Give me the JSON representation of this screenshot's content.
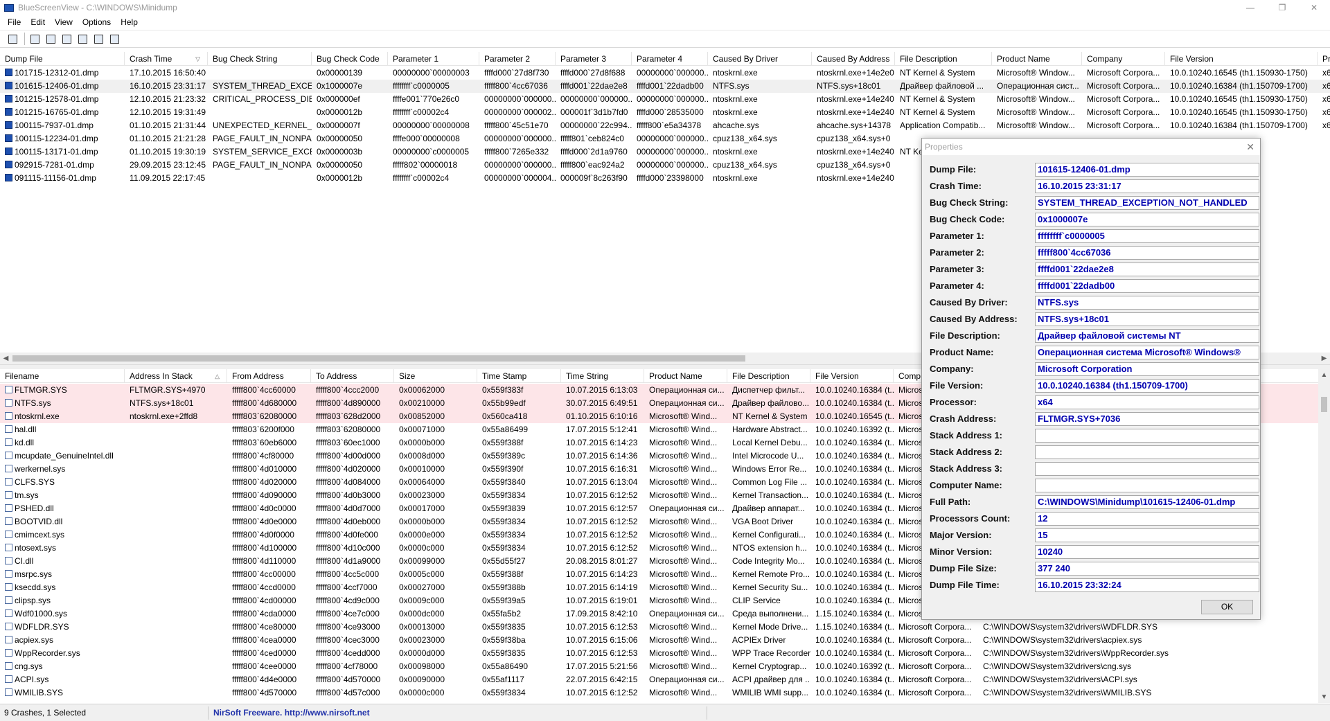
{
  "window": {
    "title": "BlueScreenView - C:\\WINDOWS\\Minidump",
    "minimize": "—",
    "maximize": "❐",
    "close": "✕"
  },
  "menu": [
    "File",
    "Edit",
    "View",
    "Options",
    "Help"
  ],
  "toolbar": [
    {
      "icon": "properties-icon"
    },
    {
      "icon": "save-icon"
    },
    {
      "icon": "refresh-icon"
    },
    {
      "icon": "copy-icon"
    },
    {
      "icon": "html-report-icon"
    },
    {
      "icon": "find-icon"
    },
    {
      "icon": "exit-icon"
    }
  ],
  "top_columns": [
    "Dump File",
    "Crash Time",
    "Bug Check String",
    "Bug Check Code",
    "Parameter 1",
    "Parameter 2",
    "Parameter 3",
    "Parameter 4",
    "Caused By Driver",
    "Caused By Address",
    "File Description",
    "Product Name",
    "Company",
    "File Version",
    "Pr"
  ],
  "top_sort_column": "Crash Time",
  "top_rows": [
    [
      "101715-12312-01.dmp",
      "17.10.2015 16:50:40",
      "",
      "0x00000139",
      "00000000`00000003",
      "ffffd000`27d8f730",
      "ffffd000`27d8f688",
      "00000000`000000...",
      "ntoskrnl.exe",
      "ntoskrnl.exe+14e2e0",
      "NT Kernel & System",
      "Microsoft® Window...",
      "Microsoft Corpora...",
      "10.0.10240.16545 (th1.150930-1750)",
      "x6"
    ],
    [
      "101615-12406-01.dmp",
      "16.10.2015 23:31:17",
      "SYSTEM_THREAD_EXCE...",
      "0x1000007e",
      "ffffffff`c0000005",
      "fffff800`4cc67036",
      "ffffd001`22dae2e8",
      "ffffd001`22dadb00",
      "NTFS.sys",
      "NTFS.sys+18c01",
      "Драйвер файловой ...",
      "Операционная сист...",
      "Microsoft Corpora...",
      "10.0.10240.16384 (th1.150709-1700)",
      "x6"
    ],
    [
      "101215-12578-01.dmp",
      "12.10.2015 21:23:32",
      "CRITICAL_PROCESS_DIED",
      "0x000000ef",
      "ffffe001`770e26c0",
      "00000000`000000...",
      "00000000`000000...",
      "00000000`000000...",
      "ntoskrnl.exe",
      "ntoskrnl.exe+14e240",
      "NT Kernel & System",
      "Microsoft® Window...",
      "Microsoft Corpora...",
      "10.0.10240.16545 (th1.150930-1750)",
      "x6"
    ],
    [
      "101215-16765-01.dmp",
      "12.10.2015 19:31:49",
      "",
      "0x0000012b",
      "ffffffff`c00002c4",
      "00000000`000002...",
      "000001f`3d1b7fd0",
      "ffffd000`28535000",
      "ntoskrnl.exe",
      "ntoskrnl.exe+14e240",
      "NT Kernel & System",
      "Microsoft® Window...",
      "Microsoft Corpora...",
      "10.0.10240.16545 (th1.150930-1750)",
      "x6"
    ],
    [
      "100115-7937-01.dmp",
      "01.10.2015 21:31:44",
      "UNEXPECTED_KERNEL_...",
      "0x0000007f",
      "00000000`00000008",
      "fffff800`45c51e70",
      "00000000`22c994...",
      "fffff800`e5a34378",
      "ahcache.sys",
      "ahcache.sys+14378",
      "Application Compatib...",
      "Microsoft® Window...",
      "Microsoft Corpora...",
      "10.0.10240.16384 (th1.150709-1700)",
      "x6"
    ],
    [
      "100115-12234-01.dmp",
      "01.10.2015 21:21:28",
      "PAGE_FAULT_IN_NONPA...",
      "0x00000050",
      "ffffe000`00000008",
      "00000000`000000...",
      "fffff801`ceb824c0",
      "00000000`000000...",
      "cpuz138_x64.sys",
      "cpuz138_x64.sys+0",
      "",
      "",
      "",
      "",
      ""
    ],
    [
      "100115-13171-01.dmp",
      "01.10.2015 19:30:19",
      "SYSTEM_SERVICE_EXCE...",
      "0x0000003b",
      "00000000`c0000005",
      "fffff800`7265e332",
      "ffffd000`2d1a9760",
      "00000000`000000...",
      "ntoskrnl.exe",
      "ntoskrnl.exe+14e240",
      "NT Ke",
      "",
      "",
      "930-1750)",
      ""
    ],
    [
      "092915-7281-01.dmp",
      "29.09.2015 23:12:45",
      "PAGE_FAULT_IN_NONPA...",
      "0x00000050",
      "fffff802`00000018",
      "00000000`000000...",
      "fffff800`eac924a2",
      "00000000`000000...",
      "cpuz138_x64.sys",
      "cpuz138_x64.sys+0",
      "",
      "",
      "",
      "",
      ""
    ],
    [
      "091115-11156-01.dmp",
      "11.09.2015 22:17:45",
      "",
      "0x0000012b",
      "ffffffff`c00002c4",
      "00000000`000004...",
      "000009f`8c263f90",
      "ffffd000`23398000",
      "ntoskrnl.exe",
      "ntoskrnl.exe+14e240",
      "",
      "",
      "",
      "930-1750)",
      ""
    ]
  ],
  "top_selected_index": 1,
  "bottom_columns": [
    "Filename",
    "Address In Stack",
    "From Address",
    "To Address",
    "Size",
    "Time Stamp",
    "Time String",
    "Product Name",
    "File Description",
    "File Version",
    "Comp"
  ],
  "bottom_sort_column": "Address In Stack",
  "bottom_rows": [
    [
      "FLTMGR.SYS",
      "FLTMGR.SYS+4970",
      "fffff800`4cc60000",
      "fffff800`4ccc2000",
      "0x00062000",
      "0x559f383f",
      "10.07.2015 6:13:03",
      "Операционная си...",
      "Диспетчер фильт...",
      "10.0.10240.16384 (t...",
      "Micros",
      ""
    ],
    [
      "NTFS.sys",
      "NTFS.sys+18c01",
      "fffff800`4d680000",
      "fffff800`4d890000",
      "0x00210000",
      "0x55b99edf",
      "30.07.2015 6:49:51",
      "Операционная си...",
      "Драйвер файлово...",
      "10.0.10240.16384 (t...",
      "Micros",
      ""
    ],
    [
      "ntoskrnl.exe",
      "ntoskrnl.exe+2ffd8",
      "fffff803`62080000",
      "fffff803`628d2000",
      "0x00852000",
      "0x560ca418",
      "01.10.2015 6:10:16",
      "Microsoft® Wind...",
      "NT Kernel & System",
      "10.0.10240.16545 (t...",
      "Micros",
      ""
    ],
    [
      "hal.dll",
      "",
      "fffff803`6200f000",
      "fffff803`62080000",
      "0x00071000",
      "0x55a86499",
      "17.07.2015 5:12:41",
      "Microsoft® Wind...",
      "Hardware Abstract...",
      "10.0.10240.16392 (t...",
      "Micros",
      ""
    ],
    [
      "kd.dll",
      "",
      "fffff803`60eb6000",
      "fffff803`60ec1000",
      "0x0000b000",
      "0x559f388f",
      "10.07.2015 6:14:23",
      "Microsoft® Wind...",
      "Local Kernel Debu...",
      "10.0.10240.16384 (t...",
      "Micros",
      ""
    ],
    [
      "mcupdate_GenuineIntel.dll",
      "",
      "fffff800`4cf80000",
      "fffff800`4d00d000",
      "0x0008d000",
      "0x559f389c",
      "10.07.2015 6:14:36",
      "Microsoft® Wind...",
      "Intel Microcode U...",
      "10.0.10240.16384 (t...",
      "Micros",
      ""
    ],
    [
      "werkernel.sys",
      "",
      "fffff800`4d010000",
      "fffff800`4d020000",
      "0x00010000",
      "0x559f390f",
      "10.07.2015 6:16:31",
      "Microsoft® Wind...",
      "Windows Error Re...",
      "10.0.10240.16384 (t...",
      "Micros",
      ""
    ],
    [
      "CLFS.SYS",
      "",
      "fffff800`4d020000",
      "fffff800`4d084000",
      "0x00064000",
      "0x559f3840",
      "10.07.2015 6:13:04",
      "Microsoft® Wind...",
      "Common Log File ...",
      "10.0.10240.16384 (t...",
      "Micros",
      ""
    ],
    [
      "tm.sys",
      "",
      "fffff800`4d090000",
      "fffff800`4d0b3000",
      "0x00023000",
      "0x559f3834",
      "10.07.2015 6:12:52",
      "Microsoft® Wind...",
      "Kernel Transaction...",
      "10.0.10240.16384 (t...",
      "Micros",
      ""
    ],
    [
      "PSHED.dll",
      "",
      "fffff800`4d0c0000",
      "fffff800`4d0d7000",
      "0x00017000",
      "0x559f3839",
      "10.07.2015 6:12:57",
      "Операционная си...",
      "Драйвер аппарат...",
      "10.0.10240.16384 (t...",
      "Micros",
      ""
    ],
    [
      "BOOTVID.dll",
      "",
      "fffff800`4d0e0000",
      "fffff800`4d0eb000",
      "0x0000b000",
      "0x559f3834",
      "10.07.2015 6:12:52",
      "Microsoft® Wind...",
      "VGA Boot Driver",
      "10.0.10240.16384 (t...",
      "Micros",
      ""
    ],
    [
      "cmimcext.sys",
      "",
      "fffff800`4d0f0000",
      "fffff800`4d0fe000",
      "0x0000e000",
      "0x559f3834",
      "10.07.2015 6:12:52",
      "Microsoft® Wind...",
      "Kernel Configurati...",
      "10.0.10240.16384 (t...",
      "Micros",
      ""
    ],
    [
      "ntosext.sys",
      "",
      "fffff800`4d100000",
      "fffff800`4d10c000",
      "0x0000c000",
      "0x559f3834",
      "10.07.2015 6:12:52",
      "Microsoft® Wind...",
      "NTOS extension h...",
      "10.0.10240.16384 (t...",
      "Micros",
      ""
    ],
    [
      "CI.dll",
      "",
      "fffff800`4d110000",
      "fffff800`4d1a9000",
      "0x00099000",
      "0x55d55f27",
      "20.08.2015 8:01:27",
      "Microsoft® Wind...",
      "Code Integrity Mo...",
      "10.0.10240.16384 (t...",
      "Micros",
      ""
    ],
    [
      "msrpc.sys",
      "",
      "fffff800`4cc00000",
      "fffff800`4cc5c000",
      "0x0005c000",
      "0x559f388f",
      "10.07.2015 6:14:23",
      "Microsoft® Wind...",
      "Kernel Remote Pro...",
      "10.0.10240.16384 (t...",
      "Micros",
      ""
    ],
    [
      "ksecdd.sys",
      "",
      "fffff800`4ccd0000",
      "fffff800`4ccf7000",
      "0x00027000",
      "0x559f388b",
      "10.07.2015 6:14:19",
      "Microsoft® Wind...",
      "Kernel Security Su...",
      "10.0.10240.16384 (t...",
      "Micros",
      ""
    ],
    [
      "clipsp.sys",
      "",
      "fffff800`4cd00000",
      "fffff800`4cd9c000",
      "0x0009c000",
      "0x559f39a5",
      "10.07.2015 6:19:01",
      "Microsoft® Wind...",
      "CLIP Service",
      "10.0.10240.16384 (t...",
      "Micros",
      ""
    ],
    [
      "Wdf01000.sys",
      "",
      "fffff800`4cda0000",
      "fffff800`4ce7c000",
      "0x000dc000",
      "0x55fa5b2",
      "17.09.2015 8:42:10",
      "Операционная си...",
      "Среда выполнени...",
      "1.15.10240.16384 (t...",
      "Micros",
      ""
    ],
    [
      "WDFLDR.SYS",
      "",
      "fffff800`4ce80000",
      "fffff800`4ce93000",
      "0x00013000",
      "0x559f3835",
      "10.07.2015 6:12:53",
      "Microsoft® Wind...",
      "Kernel Mode Drive...",
      "1.15.10240.16384 (t...",
      "Microsoft Corpora...",
      "C:\\WINDOWS\\system32\\drivers\\WDFLDR.SYS"
    ],
    [
      "acpiex.sys",
      "",
      "fffff800`4cea0000",
      "fffff800`4cec3000",
      "0x00023000",
      "0x559f38ba",
      "10.07.2015 6:15:06",
      "Microsoft® Wind...",
      "ACPIEx Driver",
      "10.0.10240.16384 (t...",
      "Microsoft Corpora...",
      "C:\\WINDOWS\\system32\\drivers\\acpiex.sys"
    ],
    [
      "WppRecorder.sys",
      "",
      "fffff800`4ced0000",
      "fffff800`4cedd000",
      "0x0000d000",
      "0x559f3835",
      "10.07.2015 6:12:53",
      "Microsoft® Wind...",
      "WPP Trace Recorder",
      "10.0.10240.16384 (t...",
      "Microsoft Corpora...",
      "C:\\WINDOWS\\system32\\drivers\\WppRecorder.sys"
    ],
    [
      "cng.sys",
      "",
      "fffff800`4cee0000",
      "fffff800`4cf78000",
      "0x00098000",
      "0x55a86490",
      "17.07.2015 5:21:56",
      "Microsoft® Wind...",
      "Kernel Cryptograp...",
      "10.0.10240.16392 (t...",
      "Microsoft Corpora...",
      "C:\\WINDOWS\\system32\\drivers\\cng.sys"
    ],
    [
      "ACPI.sys",
      "",
      "fffff800`4d4e0000",
      "fffff800`4d570000",
      "0x00090000",
      "0x55af1117",
      "22.07.2015 6:42:15",
      "Операционная си...",
      "ACPI драйвер для ...",
      "10.0.10240.16384 (t...",
      "Microsoft Corpora...",
      "C:\\WINDOWS\\system32\\drivers\\ACPI.sys"
    ],
    [
      "WMILIB.SYS",
      "",
      "fffff800`4d570000",
      "fffff800`4d57c000",
      "0x0000c000",
      "0x559f3834",
      "10.07.2015 6:12:52",
      "Microsoft® Wind...",
      "WMILIB WMI supp...",
      "10.0.10240.16384 (t...",
      "Microsoft Corpora...",
      "C:\\WINDOWS\\system32\\drivers\\WMILIB.SYS"
    ]
  ],
  "bottom_highlight_rows": 3,
  "status": {
    "left": "9 Crashes, 1 Selected",
    "right": "NirSoft Freeware.  http://www.nirsoft.net"
  },
  "dialog": {
    "title": "Properties",
    "close": "✕",
    "ok": "OK",
    "fields": [
      {
        "label": "Dump File:",
        "value": "101615-12406-01.dmp"
      },
      {
        "label": "Crash Time:",
        "value": "16.10.2015 23:31:17"
      },
      {
        "label": "Bug Check String:",
        "value": "SYSTEM_THREAD_EXCEPTION_NOT_HANDLED"
      },
      {
        "label": "Bug Check Code:",
        "value": "0x1000007e"
      },
      {
        "label": "Parameter 1:",
        "value": "ffffffff`c0000005"
      },
      {
        "label": "Parameter 2:",
        "value": "fffff800`4cc67036"
      },
      {
        "label": "Parameter 3:",
        "value": "ffffd001`22dae2e8"
      },
      {
        "label": "Parameter 4:",
        "value": "ffffd001`22dadb00"
      },
      {
        "label": "Caused By Driver:",
        "value": "NTFS.sys"
      },
      {
        "label": "Caused By Address:",
        "value": "NTFS.sys+18c01"
      },
      {
        "label": "File Description:",
        "value": "Драйвер файловой системы NT"
      },
      {
        "label": "Product Name:",
        "value": "Операционная система Microsoft® Windows®"
      },
      {
        "label": "Company:",
        "value": "Microsoft Corporation"
      },
      {
        "label": "File Version:",
        "value": "10.0.10240.16384 (th1.150709-1700)"
      },
      {
        "label": "Processor:",
        "value": "x64"
      },
      {
        "label": "Crash Address:",
        "value": "FLTMGR.SYS+7036"
      },
      {
        "label": "Stack Address 1:",
        "value": ""
      },
      {
        "label": "Stack Address 2:",
        "value": ""
      },
      {
        "label": "Stack Address 3:",
        "value": ""
      },
      {
        "label": "Computer Name:",
        "value": ""
      },
      {
        "label": "Full Path:",
        "value": "C:\\WINDOWS\\Minidump\\101615-12406-01.dmp"
      },
      {
        "label": "Processors Count:",
        "value": "12"
      },
      {
        "label": "Major Version:",
        "value": "15"
      },
      {
        "label": "Minor Version:",
        "value": "10240"
      },
      {
        "label": "Dump File Size:",
        "value": "377 240"
      },
      {
        "label": "Dump File Time:",
        "value": "16.10.2015 23:32:24"
      }
    ]
  }
}
